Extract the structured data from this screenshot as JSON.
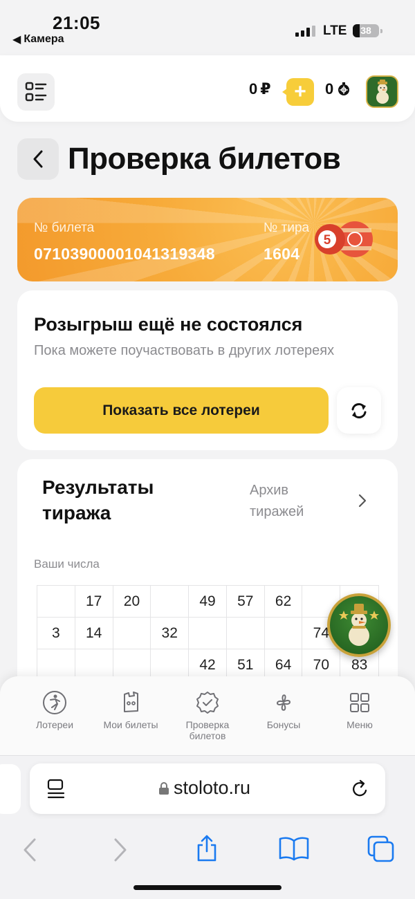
{
  "status_bar": {
    "time": "21:05",
    "back_app": "Камера",
    "network": "LTE",
    "battery": "38"
  },
  "header": {
    "balance": "0",
    "currency": "₽",
    "bonus": "0",
    "icons": [
      "menu-grid-icon",
      "plus-icon",
      "bonus-coin-icon",
      "snowman-avatar-icon"
    ]
  },
  "page": {
    "title": "Проверка билетов"
  },
  "ticket": {
    "ticket_label": "№ билета",
    "ticket_number": "07103900001041319348",
    "draw_label": "№ тира",
    "draw_number": "1604",
    "ball_number": "5"
  },
  "draw_status": {
    "title": "Розыгрыш ещё не состоялся",
    "subtitle": "Пока можете поучаствовать в других лотереях",
    "show_button": "Показать все лотереи"
  },
  "results": {
    "title": "Результаты тиража",
    "archive_link": "Архив тиражей",
    "your_numbers_label": "Ваши числа",
    "grid": [
      [
        "",
        "17",
        "20",
        "",
        "49",
        "57",
        "62",
        "",
        ""
      ],
      [
        "3",
        "14",
        "",
        "32",
        "",
        "",
        "",
        "74",
        ""
      ],
      [
        "",
        "",
        "",
        "",
        "42",
        "51",
        "64",
        "70",
        "83"
      ]
    ]
  },
  "bottom_nav": {
    "items": [
      {
        "label": "Лотереи",
        "icon": "ball-player-icon"
      },
      {
        "label": "Мои билеты",
        "icon": "ticket-icon"
      },
      {
        "label": "Проверка билетов",
        "icon": "check-badge-icon"
      },
      {
        "label": "Бонусы",
        "icon": "bonus-clover-icon"
      },
      {
        "label": "Меню",
        "icon": "grid-menu-icon"
      }
    ]
  },
  "browser": {
    "url": "stoloto.ru"
  },
  "colors": {
    "accent_yellow": "#f6cb3b",
    "ticket_orange": "#f7ab3a",
    "ios_blue": "#1a7af0"
  }
}
